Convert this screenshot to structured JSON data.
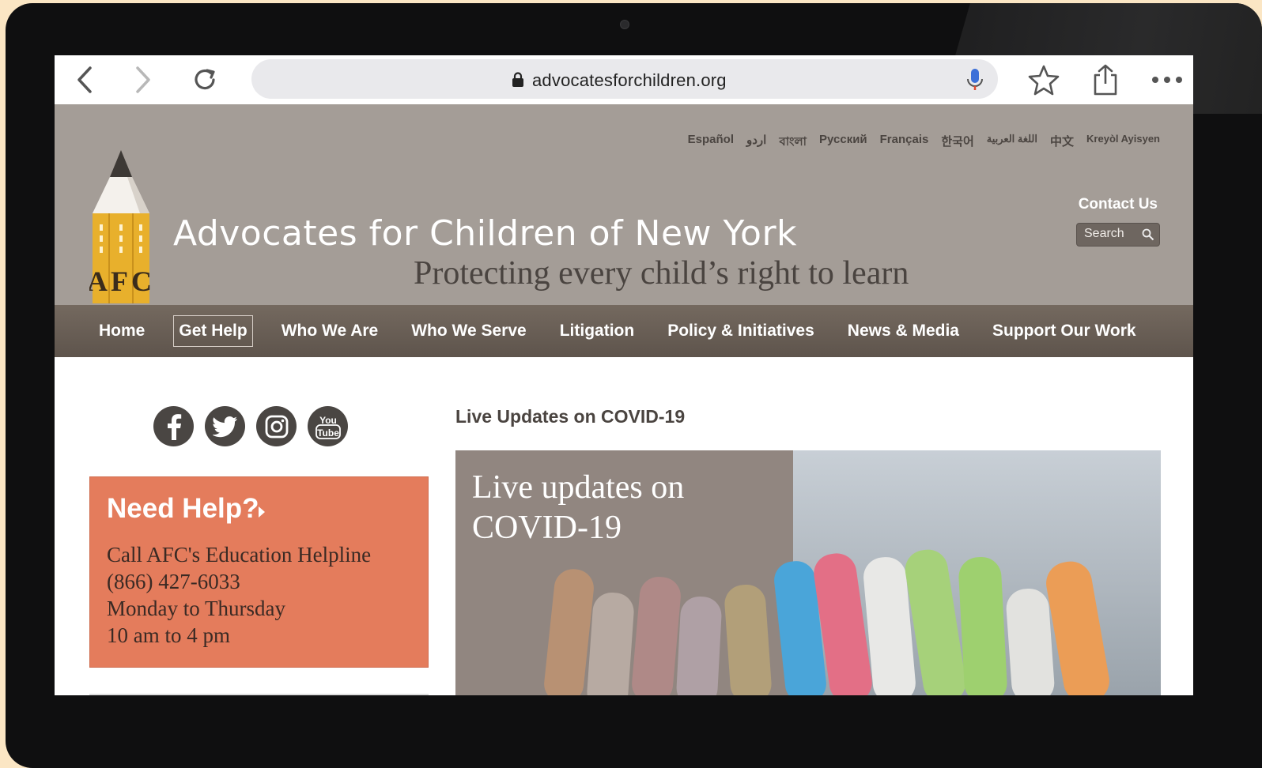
{
  "browser": {
    "url": "advocatesforchildren.org"
  },
  "header": {
    "languages": [
      "Español",
      "اردو",
      "বাংলা",
      "Русский",
      "Français",
      "한국어",
      "اللغة العربية",
      "中文",
      "Kreyòl Ayisyen"
    ],
    "logo_text": "AFC",
    "title": "Advocates for Children of New York",
    "tagline": "Protecting every child’s right to learn",
    "contact": "Contact Us",
    "search_placeholder": "Search"
  },
  "nav": {
    "items": [
      "Home",
      "Get Help",
      "Who We Are",
      "Who We Serve",
      "Litigation",
      "Policy & Initiatives",
      "News & Media",
      "Support Our Work"
    ],
    "active_index": 1
  },
  "social": {
    "icons": [
      "facebook-icon",
      "twitter-icon",
      "instagram-icon",
      "youtube-icon"
    ],
    "youtube_top": "You",
    "youtube_bottom": "Tube"
  },
  "help": {
    "title": "Need Help?",
    "lines": [
      "Call AFC's Education Helpline",
      "(866) 427-6033",
      "Monday to Thursday",
      "10 am to 4 pm"
    ]
  },
  "main": {
    "heading": "Live Updates on COVID-19",
    "feature_title_line1": "Live updates on",
    "feature_title_line2": "COVID-19"
  },
  "colors": {
    "header_bg": "#a49d97",
    "nav_bg": "#6a5f56",
    "help_bg": "#e47c5c",
    "logo_yellow": "#e8b02c"
  }
}
